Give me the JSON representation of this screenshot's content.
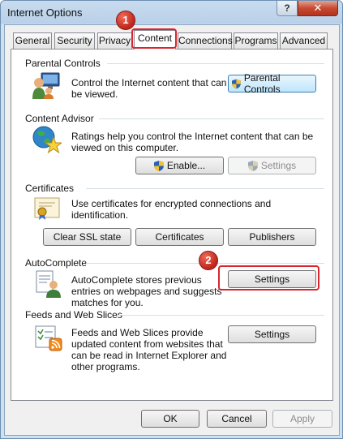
{
  "window": {
    "title": "Internet Options",
    "help_glyph": "?",
    "close_glyph": "✕"
  },
  "tabs": [
    {
      "label": "General"
    },
    {
      "label": "Security"
    },
    {
      "label": "Privacy"
    },
    {
      "label": "Content",
      "active": true
    },
    {
      "label": "Connections"
    },
    {
      "label": "Programs"
    },
    {
      "label": "Advanced"
    }
  ],
  "parental_controls": {
    "title": "Parental Controls",
    "description": "Control the Internet content that can be viewed.",
    "button": "Parental Controls"
  },
  "content_advisor": {
    "title": "Content Advisor",
    "description": "Ratings help you control the Internet content that can be viewed on this computer.",
    "enable_button": "Enable...",
    "settings_button": "Settings"
  },
  "certificates": {
    "title": "Certificates",
    "description": "Use certificates for encrypted connections and identification.",
    "clear_ssl_button": "Clear SSL state",
    "certificates_button": "Certificates",
    "publishers_button": "Publishers"
  },
  "autocomplete": {
    "title": "AutoComplete",
    "description": "AutoComplete stores previous entries on webpages and suggests matches for you.",
    "settings_button": "Settings"
  },
  "feeds": {
    "title": "Feeds and Web Slices",
    "description": "Feeds and Web Slices provide updated content from websites that can be read in Internet Explorer and other programs.",
    "settings_button": "Settings"
  },
  "footer": {
    "ok": "OK",
    "cancel": "Cancel",
    "apply": "Apply"
  },
  "annotations": {
    "step1": "1",
    "step2": "2",
    "highlight_color": "#d8262e"
  },
  "icons": {
    "uac_shield": "uac-shield-icon",
    "parental": "parental-controls-icon",
    "advisor": "content-advisor-icon",
    "certificate": "certificate-icon",
    "autocomplete": "autocomplete-icon",
    "feeds": "feeds-icon"
  }
}
